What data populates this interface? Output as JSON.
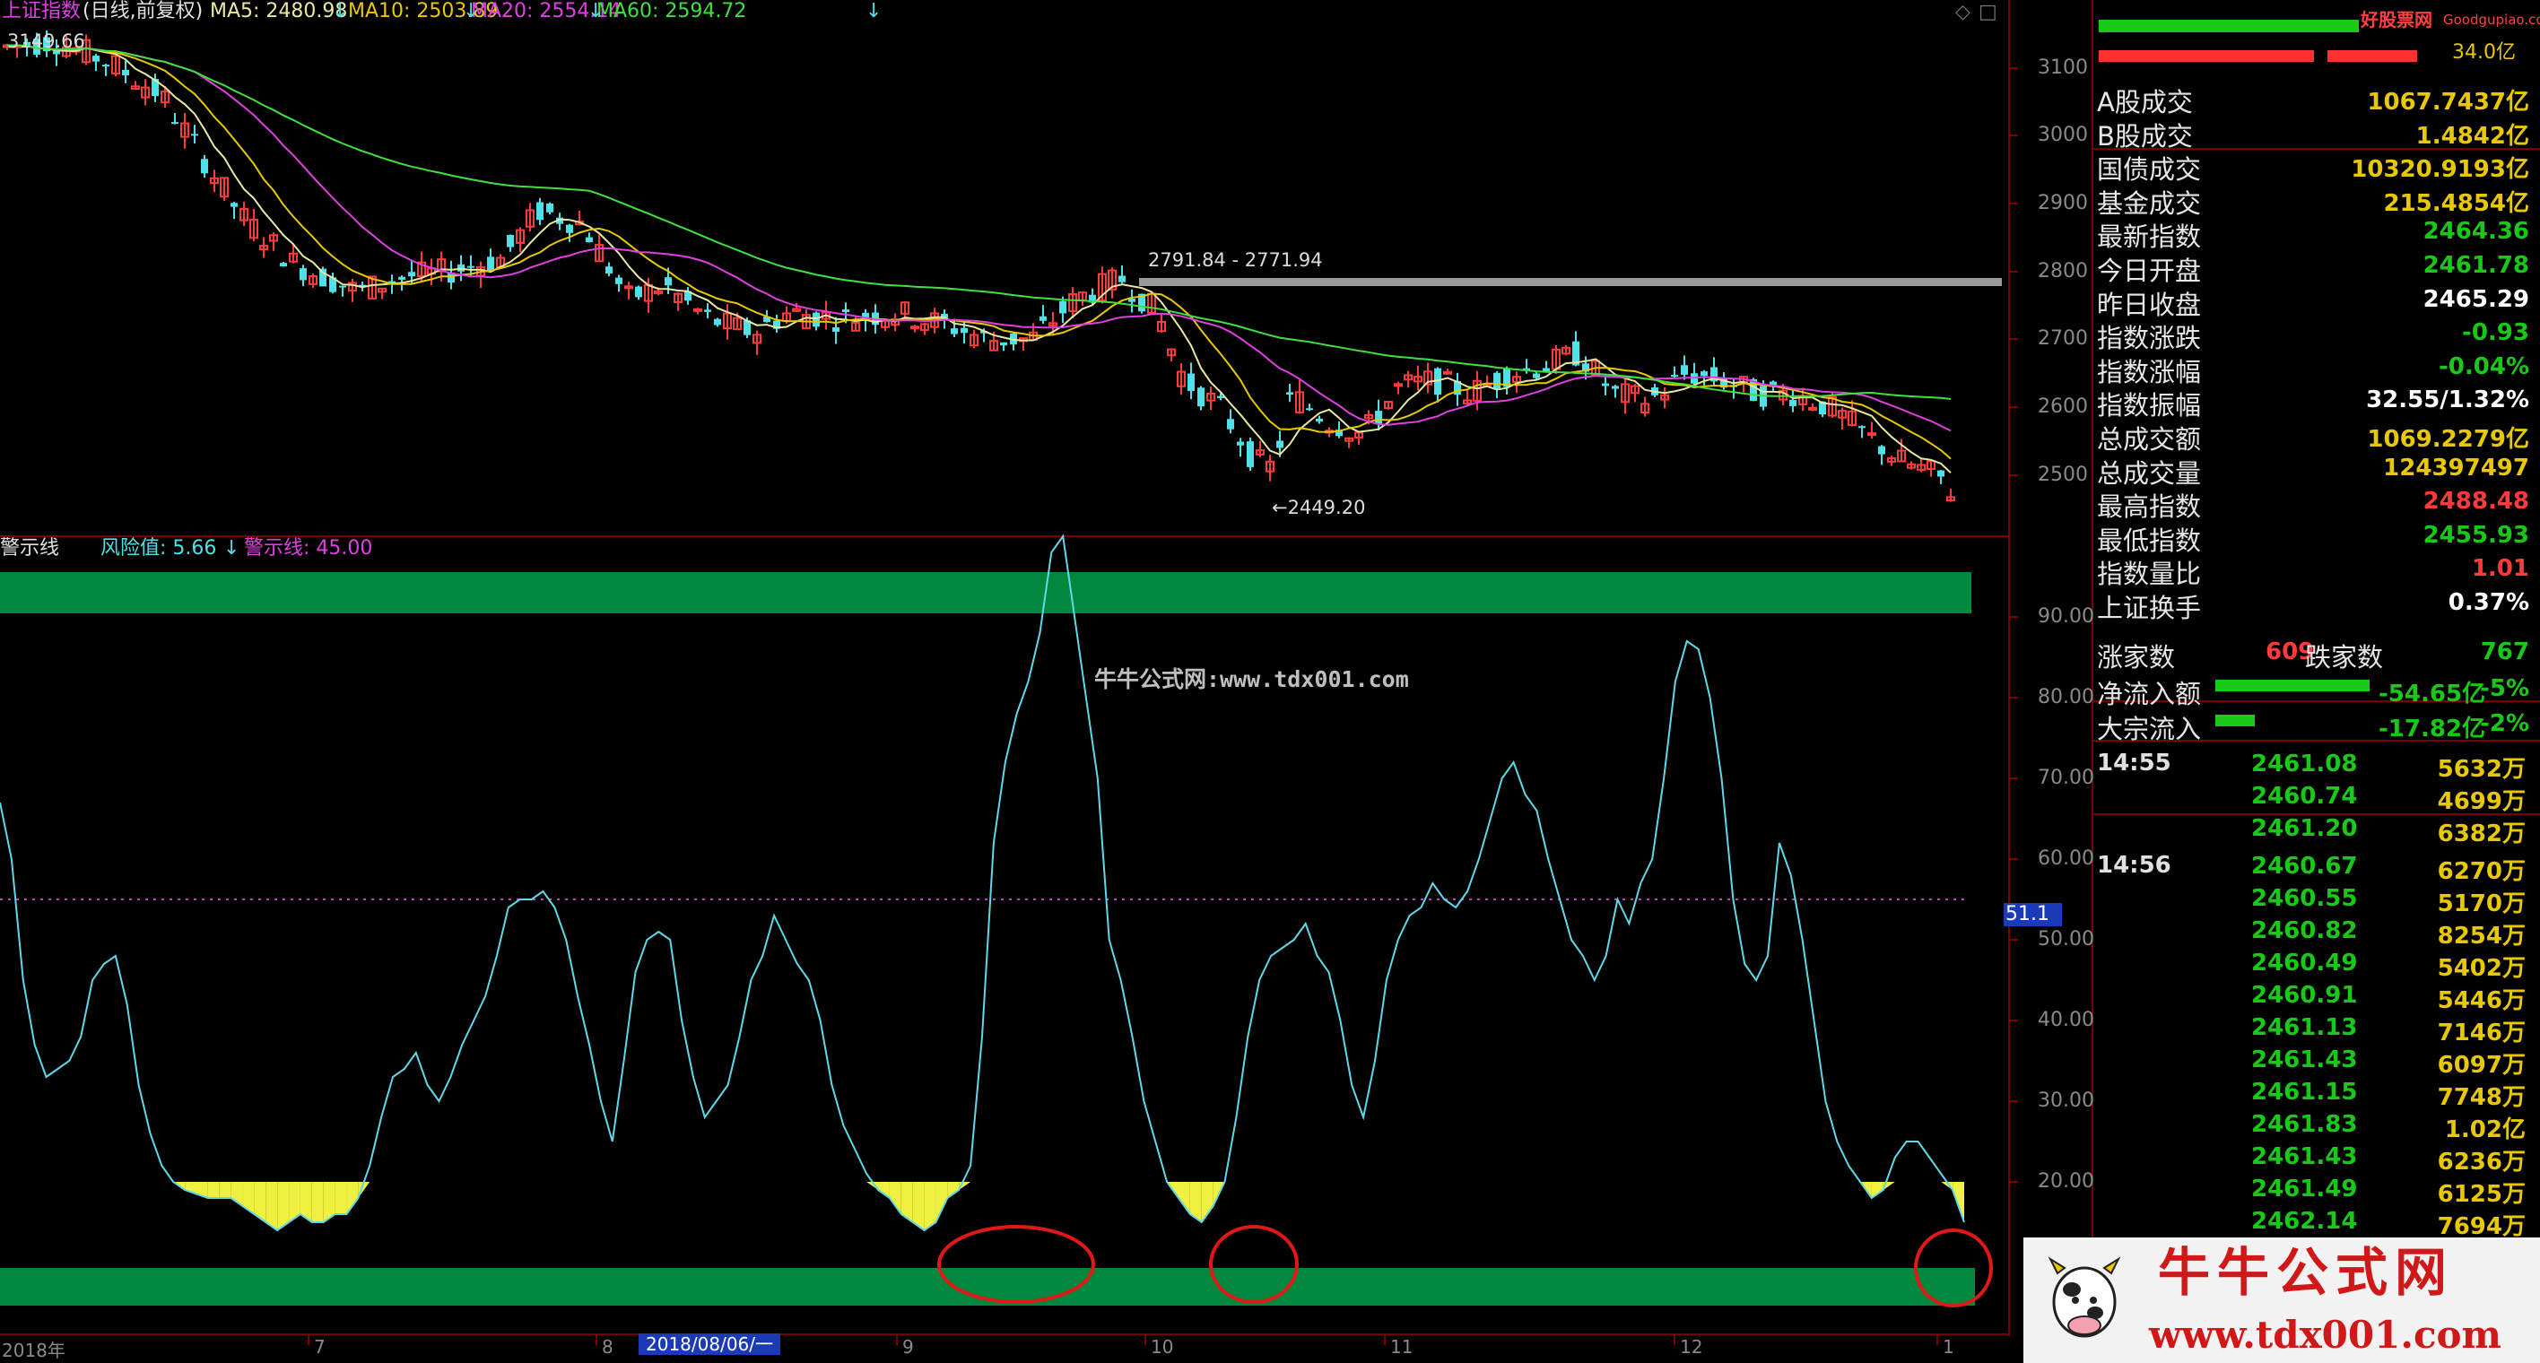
{
  "header": {
    "index_name": "上证指数",
    "mode": "(日线,前复权)",
    "ma5": "MA5: 2480.98",
    "ma10": "MA10: 2503.89",
    "ma20": "MA20: 2554.14",
    "ma60": "MA60: 2594.72",
    "arrow": "↓"
  },
  "price_chart": {
    "high_label": "3149.66",
    "range_label": "2791.84 - 2771.94",
    "low_label": "←2449.20",
    "y_ticks": [
      "3100",
      "3000",
      "2900",
      "2800",
      "2700",
      "2600",
      "2500"
    ]
  },
  "indicator": {
    "name": "警示线",
    "risk_label": "风险值: 5.66",
    "warn_label": "警示线: 45.00",
    "current_value": "51.1",
    "y_ticks": [
      "90.00",
      "80.00",
      "70.00",
      "60.00",
      "50.00",
      "40.00",
      "30.00",
      "20.00"
    ],
    "watermark": "牛牛公式网:www.tdx001.com",
    "series": [
      57,
      50,
      35,
      27,
      23,
      24,
      25,
      28,
      35,
      37,
      38,
      32,
      22,
      16,
      12,
      10,
      9,
      8.5,
      8,
      8,
      8,
      7,
      6,
      5,
      4,
      5,
      6,
      5,
      5,
      6,
      6,
      8,
      12,
      18,
      23,
      24,
      26,
      22,
      20,
      23,
      27,
      30,
      33,
      38,
      44,
      45,
      45,
      46,
      44,
      40,
      33,
      27,
      20,
      15,
      25,
      36,
      40,
      41,
      40,
      30,
      23,
      18,
      20,
      22,
      28,
      35,
      38,
      43,
      40,
      37,
      35,
      30,
      22,
      17,
      14,
      11,
      9,
      8,
      6,
      5,
      4,
      5,
      8,
      9,
      12,
      28,
      52,
      62,
      68,
      72,
      78,
      88,
      90,
      80,
      70,
      60,
      40,
      35,
      28,
      20,
      15,
      10,
      8,
      6,
      5,
      7,
      10,
      18,
      28,
      35,
      38,
      39,
      40,
      42,
      38,
      36,
      30,
      22,
      18,
      25,
      35,
      40,
      43,
      44,
      47,
      45,
      44,
      46,
      50,
      55,
      60,
      62,
      58,
      56,
      50,
      45,
      40,
      38,
      35,
      38,
      45,
      42,
      47,
      50,
      60,
      72,
      77,
      76,
      70,
      60,
      45,
      37,
      35,
      38,
      52,
      48,
      40,
      30,
      20,
      15,
      12,
      10,
      8,
      9,
      13,
      15,
      15,
      13,
      11,
      9,
      5
    ],
    "x_labels": [
      {
        "t": "2018年"
      },
      {
        "t": "7"
      },
      {
        "t": "8"
      },
      {
        "t": "9"
      },
      {
        "t": "10"
      },
      {
        "t": "11"
      },
      {
        "t": "12"
      },
      {
        "t": "1"
      }
    ],
    "date_box": "2018/08/06/一"
  },
  "logo": {
    "brand_top": "好股票网",
    "brand_url": "Goodgupiao.com",
    "text": "牛牛公式网",
    "url": "www.tdx001.com"
  },
  "panel": {
    "top_value": "34.0亿",
    "rows": [
      {
        "label": "A股成交",
        "value": "1067.7437亿",
        "color": "#e8c800"
      },
      {
        "label": "B股成交",
        "value": "1.4842亿",
        "color": "#e8c800"
      },
      {
        "label": "国债成交",
        "value": "10320.9193亿",
        "color": "#e8c800"
      },
      {
        "label": "基金成交",
        "value": "215.4854亿",
        "color": "#e8c800"
      },
      {
        "label": "最新指数",
        "value": "2464.36",
        "color": "#18c918"
      },
      {
        "label": "今日开盘",
        "value": "2461.78",
        "color": "#18c918"
      },
      {
        "label": "昨日收盘",
        "value": "2465.29",
        "color": "#ffffff"
      },
      {
        "label": "指数涨跌",
        "value": "-0.93",
        "color": "#18c918"
      },
      {
        "label": "指数涨幅",
        "value": "-0.04%",
        "color": "#18c918"
      },
      {
        "label": "指数振幅",
        "value": "32.55/1.32%",
        "color": "#ffffff"
      },
      {
        "label": "总成交额",
        "value": "1069.2279亿",
        "color": "#e8c800"
      },
      {
        "label": "总成交量",
        "value": "124397497",
        "color": "#e8c800"
      },
      {
        "label": "最高指数",
        "value": "2488.48",
        "color": "#ff3b3b"
      },
      {
        "label": "最低指数",
        "value": "2455.93",
        "color": "#18c918"
      },
      {
        "label": "指数量比",
        "value": "1.01",
        "color": "#ff3b3b"
      },
      {
        "label": "上证换手",
        "value": "0.37%",
        "color": "#ffffff"
      }
    ],
    "rise_label": "涨家数",
    "rise_value": "609",
    "fall_label": "跌家数",
    "fall_value": "767",
    "net_inflow_label": "净流入额",
    "net_inflow_value": "-54.65亿",
    "net_inflow_pct": "-5%",
    "block_inflow_label": "大宗流入",
    "block_inflow_value": "-17.82亿",
    "block_inflow_pct": "-2%",
    "ticks": [
      {
        "time": "14:55",
        "price": "2461.08",
        "vol": "5632万"
      },
      {
        "time": "",
        "price": "2460.74",
        "vol": "4699万"
      },
      {
        "time": "",
        "price": "2461.20",
        "vol": "6382万"
      },
      {
        "time": "14:56",
        "price": "2460.67",
        "vol": "6270万"
      },
      {
        "time": "",
        "price": "2460.55",
        "vol": "5170万"
      },
      {
        "time": "",
        "price": "2460.82",
        "vol": "8254万"
      },
      {
        "time": "",
        "price": "2460.49",
        "vol": "5402万"
      },
      {
        "time": "",
        "price": "2460.91",
        "vol": "5446万"
      },
      {
        "time": "",
        "price": "2461.13",
        "vol": "7146万"
      },
      {
        "time": "",
        "price": "2461.43",
        "vol": "6097万"
      },
      {
        "time": "",
        "price": "2461.15",
        "vol": "7748万"
      },
      {
        "time": "",
        "price": "2461.83",
        "vol": "1.02亿"
      },
      {
        "time": "",
        "price": "2461.43",
        "vol": "6236万"
      },
      {
        "time": "",
        "price": "2461.49",
        "vol": "6125万"
      },
      {
        "time": "",
        "price": "2462.14",
        "vol": "7694万"
      }
    ]
  },
  "colors": {
    "up": "#ff3b3b",
    "down": "#4fe0e8",
    "ma5": "#e8e8a0",
    "ma10": "#e8c800",
    "ma20": "#e040e0",
    "ma60": "#40e040",
    "band": "#00883e",
    "indicator_line": "#5fd8e8"
  }
}
